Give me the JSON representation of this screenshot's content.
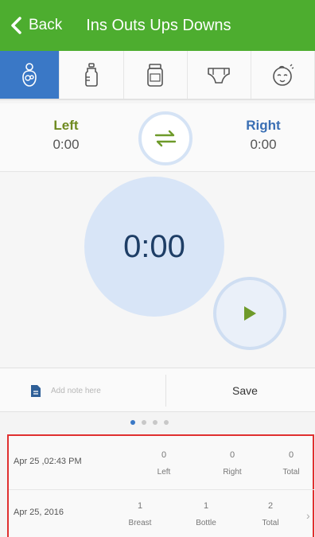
{
  "header": {
    "back_label": "Back",
    "title": "Ins Outs Ups Downs"
  },
  "tabs": [
    {
      "name": "breastfeed",
      "icon": "breastfeed-icon",
      "active": true
    },
    {
      "name": "bottle",
      "icon": "bottle-icon",
      "active": false
    },
    {
      "name": "jar",
      "icon": "jar-icon",
      "active": false
    },
    {
      "name": "diaper",
      "icon": "diaper-icon",
      "active": false
    },
    {
      "name": "baby",
      "icon": "baby-face-icon",
      "active": false
    }
  ],
  "sides": {
    "left": {
      "label": "Left",
      "time": "0:00"
    },
    "right": {
      "label": "Right",
      "time": "0:00"
    }
  },
  "timer": {
    "value": "0:00"
  },
  "note": {
    "placeholder": "Add note here"
  },
  "save_label": "Save",
  "pagination": {
    "count": 4,
    "active_index": 0
  },
  "history": [
    {
      "date": "Apr 25 ,02:43 PM",
      "cells": [
        {
          "value": "0",
          "label": "Left"
        },
        {
          "value": "0",
          "label": "Right"
        },
        {
          "value": "0",
          "label": "Total"
        }
      ]
    },
    {
      "date": "Apr 25, 2016",
      "cells": [
        {
          "value": "1",
          "label": "Breast"
        },
        {
          "value": "1",
          "label": "Bottle"
        },
        {
          "value": "2",
          "label": "Total"
        }
      ]
    }
  ],
  "colors": {
    "header": "#4dad2f",
    "active_tab": "#3a78c6",
    "left_label": "#6e8a20",
    "right_label": "#3a6fb4",
    "timer_circle": "#d8e5f7",
    "play_icon": "#6e9a2a",
    "highlight_border": "#e03030"
  }
}
